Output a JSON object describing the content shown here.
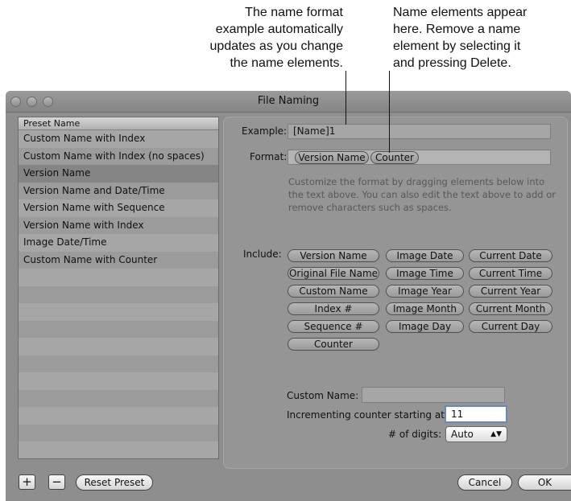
{
  "callouts": {
    "left": [
      "The name format",
      "example automatically",
      "updates as you change",
      "the name elements."
    ],
    "right": [
      "Name elements appear",
      "here. Remove a name",
      "element by selecting it",
      "and pressing Delete."
    ]
  },
  "window": {
    "title": "File Naming"
  },
  "list": {
    "header": "Preset Name",
    "items": [
      "Custom Name with Index",
      "Custom Name with Index (no spaces)",
      "Version Name",
      "Version Name and Date/Time",
      "Version Name with Sequence",
      "Version Name with Index",
      "Image Date/Time",
      "Custom Name with Counter"
    ],
    "selected": "Version Name"
  },
  "example": {
    "label": "Example:",
    "value": "[Name]1"
  },
  "format": {
    "label": "Format:",
    "tokens": [
      "Version Name",
      "Counter"
    ]
  },
  "help_text": "Customize the format by dragging elements below into the text above. You can also edit the text above to add or remove characters such as spaces.",
  "include": {
    "label": "Include:",
    "tokens": [
      "Version Name",
      "Image Date",
      "Current Date",
      "Original File Name",
      "Image Time",
      "Current Time",
      "Custom Name",
      "Image Year",
      "Current Year",
      "Index #",
      "Image Month",
      "Current Month",
      "Sequence #",
      "Image Day",
      "Current Day",
      "Counter"
    ]
  },
  "custom_name": {
    "label": "Custom Name:",
    "value": ""
  },
  "counter_start": {
    "label": "Incrementing counter starting at:",
    "value": "11"
  },
  "digits": {
    "label": "# of digits:",
    "value": "Auto"
  },
  "buttons": {
    "add": "+",
    "remove": "−",
    "reset": "Reset Preset",
    "cancel": "Cancel",
    "ok": "OK"
  }
}
